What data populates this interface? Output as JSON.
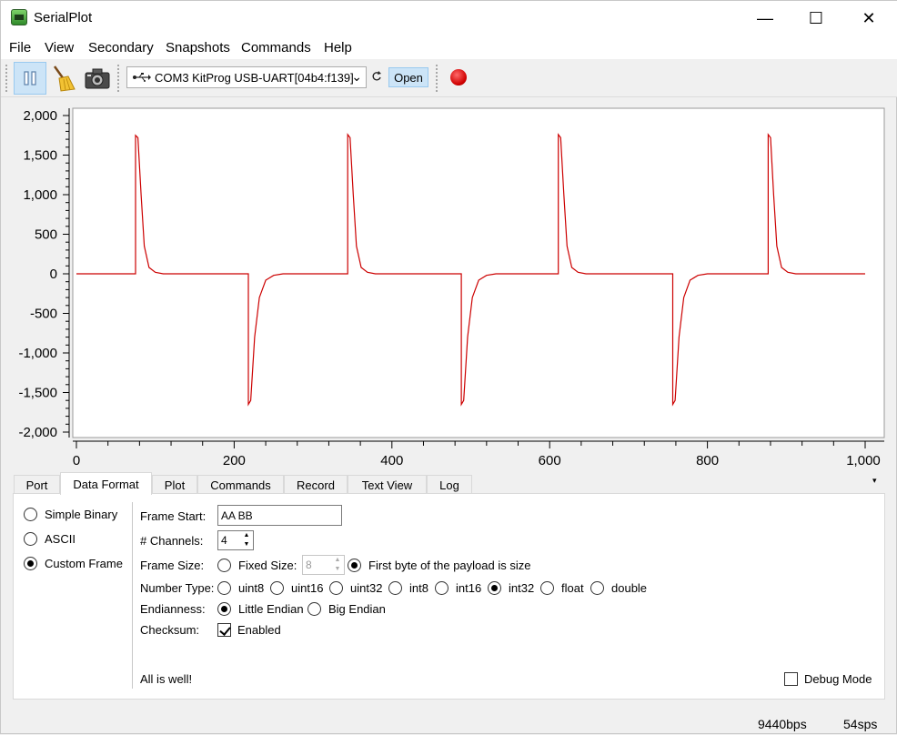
{
  "window": {
    "title": "SerialPlot",
    "controls": {
      "minimize": "—",
      "maximize": "☐",
      "close": "✕"
    }
  },
  "menu": {
    "items": [
      "File",
      "View",
      "Secondary",
      "Snapshots",
      "Commands",
      "Help"
    ]
  },
  "toolbar": {
    "pause_icon": "pause-icon",
    "clear_icon": "broom-icon",
    "snapshot_icon": "camera-icon",
    "port_icon": "usb-icon",
    "port_value": "COM3 KitProg USB-UART[04b4:f139]",
    "refresh_icon": "refresh-icon",
    "open_label": "Open",
    "record_icon": "record-icon"
  },
  "chart_data": {
    "type": "line",
    "xlim": [
      0,
      1000
    ],
    "ylim": [
      -2000,
      2000
    ],
    "x_ticks": [
      "0",
      "200",
      "400",
      "600",
      "800",
      "1,000"
    ],
    "x_tick_values": [
      0,
      200,
      400,
      600,
      800,
      1000
    ],
    "y_ticks": [
      "2,000",
      "1,500",
      "1,000",
      "500",
      "0",
      "-500",
      "-1,000",
      "-1,500",
      "-2,000"
    ],
    "y_tick_values": [
      2000,
      1500,
      1000,
      500,
      0,
      -500,
      -1000,
      -1500,
      -2000
    ],
    "grid": false,
    "series": [
      {
        "color": "#cc0000",
        "points": [
          [
            0,
            0
          ],
          [
            75,
            0
          ],
          [
            75,
            1750
          ],
          [
            78,
            1720
          ],
          [
            82,
            1000
          ],
          [
            86,
            350
          ],
          [
            92,
            80
          ],
          [
            100,
            20
          ],
          [
            110,
            0
          ],
          [
            218,
            0
          ],
          [
            218,
            -1650
          ],
          [
            221,
            -1600
          ],
          [
            226,
            -800
          ],
          [
            232,
            -300
          ],
          [
            240,
            -80
          ],
          [
            250,
            -20
          ],
          [
            262,
            0
          ],
          [
            344,
            0
          ],
          [
            344,
            1760
          ],
          [
            347,
            1720
          ],
          [
            351,
            1000
          ],
          [
            355,
            350
          ],
          [
            361,
            80
          ],
          [
            369,
            20
          ],
          [
            379,
            0
          ],
          [
            488,
            0
          ],
          [
            488,
            -1650
          ],
          [
            491,
            -1600
          ],
          [
            496,
            -800
          ],
          [
            502,
            -300
          ],
          [
            510,
            -80
          ],
          [
            520,
            -20
          ],
          [
            532,
            0
          ],
          [
            611,
            0
          ],
          [
            611,
            1760
          ],
          [
            614,
            1720
          ],
          [
            618,
            1000
          ],
          [
            622,
            350
          ],
          [
            628,
            80
          ],
          [
            636,
            20
          ],
          [
            646,
            0
          ],
          [
            756,
            0
          ],
          [
            756,
            -1650
          ],
          [
            759,
            -1600
          ],
          [
            764,
            -800
          ],
          [
            770,
            -300
          ],
          [
            778,
            -80
          ],
          [
            788,
            -20
          ],
          [
            800,
            0
          ],
          [
            877,
            0
          ],
          [
            877,
            1760
          ],
          [
            880,
            1720
          ],
          [
            884,
            1000
          ],
          [
            888,
            350
          ],
          [
            894,
            80
          ],
          [
            902,
            20
          ],
          [
            912,
            0
          ],
          [
            1000,
            0
          ]
        ]
      }
    ]
  },
  "tabs": {
    "items": [
      "Port",
      "Data Format",
      "Plot",
      "Commands",
      "Record",
      "Text View",
      "Log"
    ],
    "active": "Data Format",
    "menu_glyph": "▾"
  },
  "data_format": {
    "format_options": [
      {
        "label": "Simple Binary",
        "selected": false
      },
      {
        "label": "ASCII",
        "selected": false
      },
      {
        "label": "Custom Frame",
        "selected": true
      }
    ],
    "frame_start_label": "Frame Start:",
    "frame_start_value": "AA BB",
    "channels_label": "# Channels:",
    "channels_value": "4",
    "frame_size_label": "Frame Size:",
    "fixed_size_label": "Fixed Size:",
    "fixed_size_value": "8",
    "first_byte_label": "First byte of the payload is size",
    "number_type_label": "Number Type:",
    "number_types": [
      "uint8",
      "uint16",
      "uint32",
      "int8",
      "int16",
      "int32",
      "float",
      "double"
    ],
    "number_type_selected": "int32",
    "endianness_label": "Endianness:",
    "endianness_options": [
      "Little Endian",
      "Big Endian"
    ],
    "endianness_selected": "Little Endian",
    "checksum_label": "Checksum:",
    "checksum_enabled_label": "Enabled",
    "checksum_enabled": true,
    "status_message": "All is well!",
    "debug_mode_label": "Debug Mode",
    "debug_mode": false
  },
  "status_bar": {
    "bps": "9440bps",
    "sps": "54sps"
  }
}
